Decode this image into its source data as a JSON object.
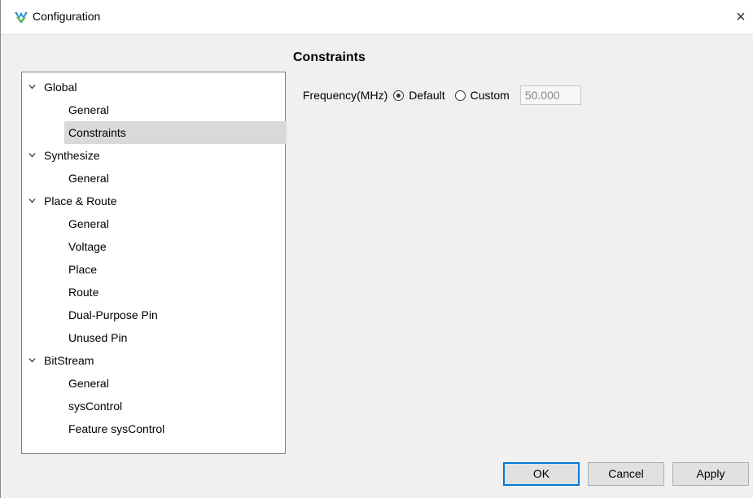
{
  "window": {
    "title": "Configuration",
    "close_glyph": "×"
  },
  "tree": [
    {
      "label": "Global",
      "expanded": true,
      "children": [
        {
          "label": "General",
          "selected": false
        },
        {
          "label": "Constraints",
          "selected": true
        }
      ]
    },
    {
      "label": "Synthesize",
      "expanded": true,
      "children": [
        {
          "label": "General",
          "selected": false
        }
      ]
    },
    {
      "label": "Place & Route",
      "expanded": true,
      "children": [
        {
          "label": "General",
          "selected": false
        },
        {
          "label": "Voltage",
          "selected": false
        },
        {
          "label": "Place",
          "selected": false
        },
        {
          "label": "Route",
          "selected": false
        },
        {
          "label": "Dual-Purpose Pin",
          "selected": false
        },
        {
          "label": "Unused Pin",
          "selected": false
        }
      ]
    },
    {
      "label": "BitStream",
      "expanded": true,
      "children": [
        {
          "label": "General",
          "selected": false
        },
        {
          "label": "sysControl",
          "selected": false
        },
        {
          "label": "Feature sysControl",
          "selected": false
        }
      ]
    }
  ],
  "panel": {
    "title": "Constraints",
    "frequency": {
      "label": "Frequency(MHz)",
      "options": [
        {
          "label": "Default",
          "checked": true
        },
        {
          "label": "Custom",
          "checked": false
        }
      ],
      "value": "50.000",
      "disabled": true
    }
  },
  "buttons": {
    "ok": "OK",
    "cancel": "Cancel",
    "apply": "Apply"
  },
  "colors": {
    "accent": "#0078d7",
    "selection": "#d9d9d9",
    "background": "#f0f0f0"
  }
}
